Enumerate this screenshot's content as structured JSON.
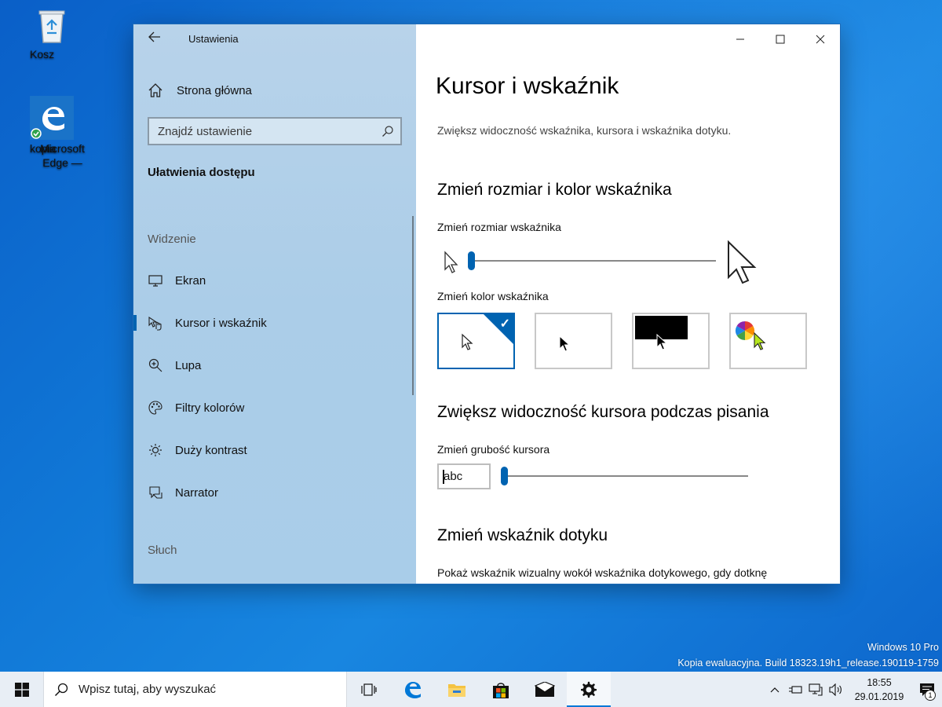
{
  "desktop": {
    "icons": [
      {
        "label": "Kosz",
        "icon": "recycle-bin-icon"
      },
      {
        "label": "Microsoft Edge —\nkopia",
        "label_line1": "Microsoft Edge —",
        "label_line2": "kopia",
        "icon": "edge-icon"
      }
    ],
    "watermark": {
      "line1": "Windows 10 Pro",
      "line2": "Kopia ewaluacyjna. Build 18323.19h1_release.190119-1759"
    }
  },
  "window": {
    "app_title": "Ustawienia",
    "sidebar": {
      "home_label": "Strona główna",
      "search_placeholder": "Znajdź ustawienie",
      "section_title": "Ułatwienia dostępu",
      "group_vision": "Widzenie",
      "items": [
        {
          "label": "Ekran",
          "icon": "monitor-icon",
          "selected": false
        },
        {
          "label": "Kursor i wskaźnik",
          "icon": "pointer-hand-icon",
          "selected": true
        },
        {
          "label": "Lupa",
          "icon": "magnifier-icon",
          "selected": false
        },
        {
          "label": "Filtry kolorów",
          "icon": "palette-icon",
          "selected": false
        },
        {
          "label": "Duży kontrast",
          "icon": "brightness-icon",
          "selected": false
        },
        {
          "label": "Narrator",
          "icon": "narrator-icon",
          "selected": false
        }
      ],
      "group_hearing": "Słuch"
    },
    "content": {
      "title": "Kursor i wskaźnik",
      "description": "Zwiększ widoczność wskaźnika, kursora i wskaźnika dotyku.",
      "section1_heading": "Zmień rozmiar i kolor wskaźnika",
      "size_label": "Zmień rozmiar wskaźnika",
      "size_value_fraction": 0.0,
      "color_label": "Zmień kolor wskaźnika",
      "color_options": [
        {
          "name": "white",
          "selected": true
        },
        {
          "name": "black",
          "selected": false
        },
        {
          "name": "inverted",
          "selected": false
        },
        {
          "name": "custom",
          "selected": false
        }
      ],
      "section2_heading": "Zwiększ widoczność kursora podczas pisania",
      "thickness_label": "Zmień grubość kursora",
      "thickness_preview": "abc",
      "thickness_value_fraction": 0.0,
      "section3_heading": "Zmień wskaźnik dotyku",
      "touch_text": "Pokaż wskaźnik wizualny wokół wskaźnika dotykowego, gdy dotknę"
    }
  },
  "taskbar": {
    "search_placeholder": "Wpisz tutaj, aby wyszukać",
    "time": "18:55",
    "date": "29.01.2019",
    "notification_count": "1",
    "accent": "#0078d7"
  }
}
